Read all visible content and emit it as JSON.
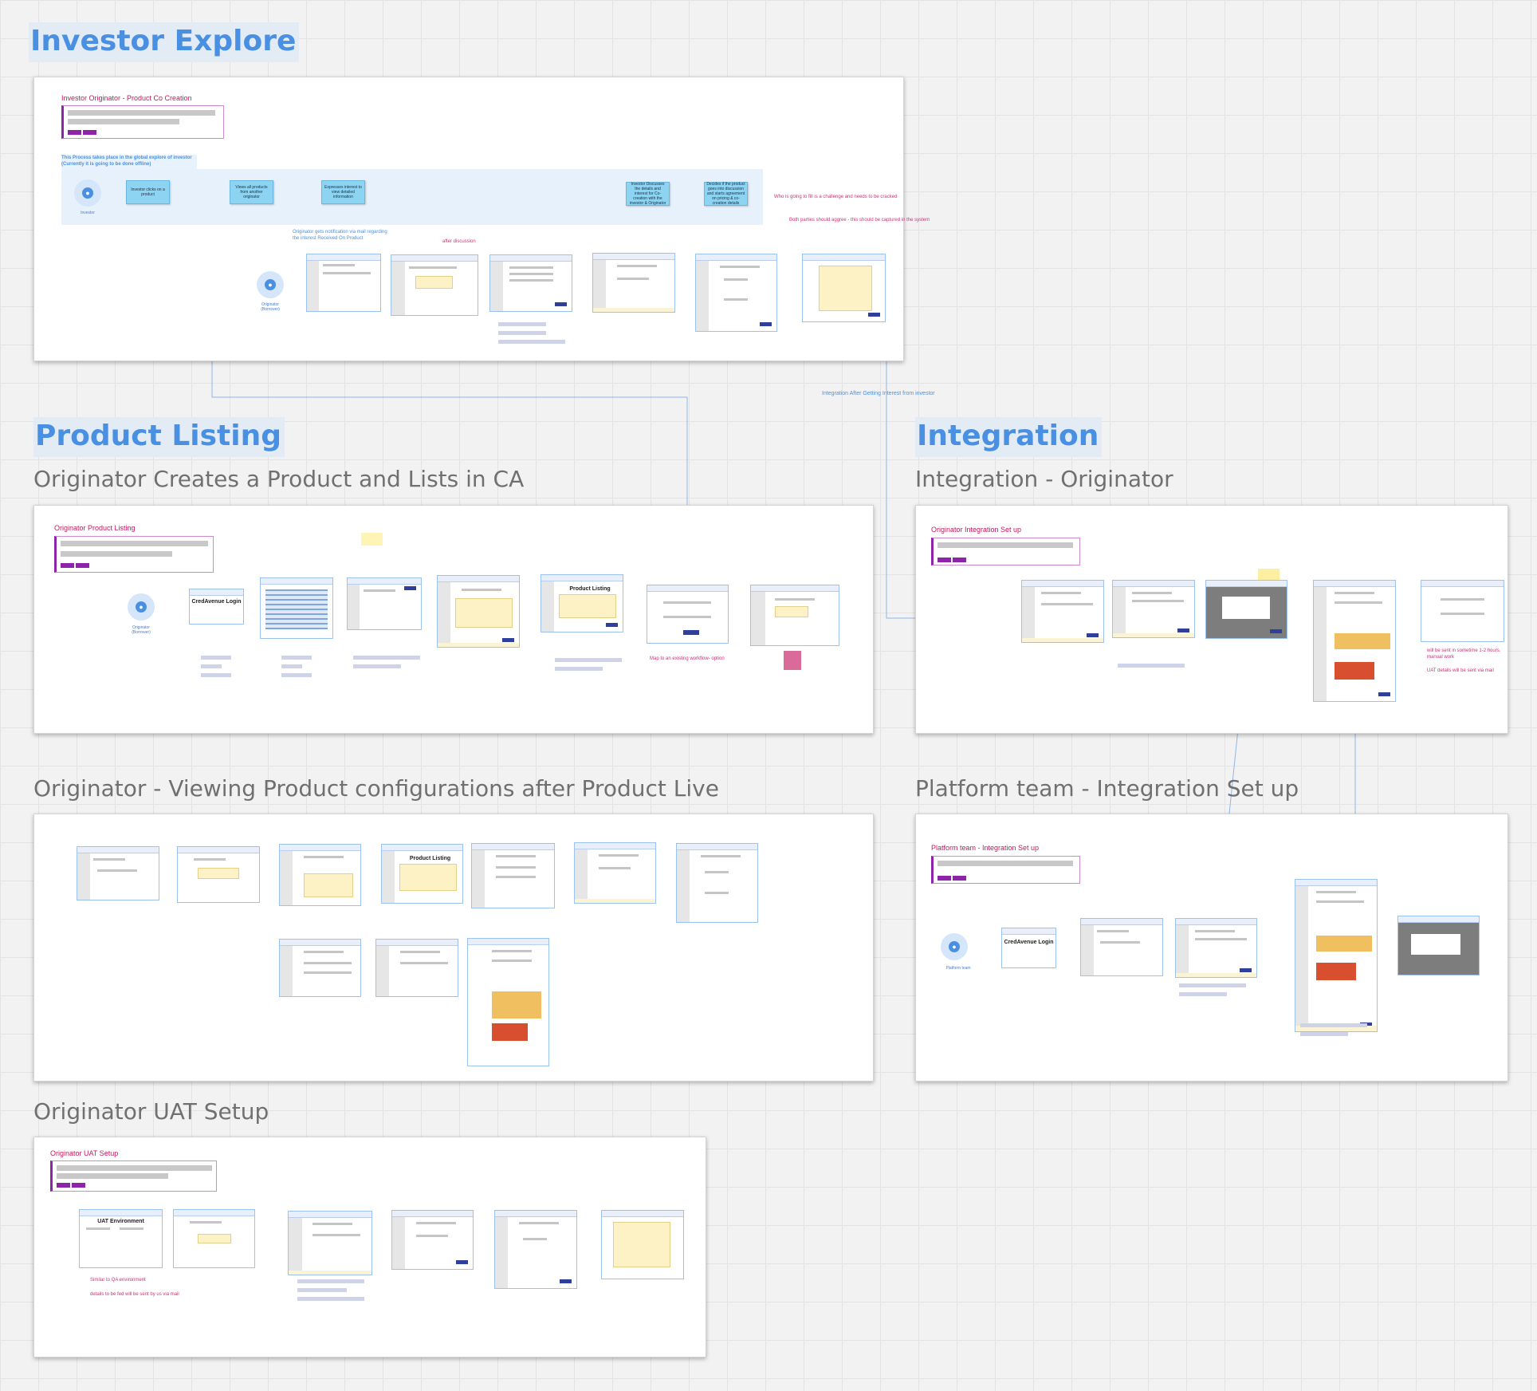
{
  "sections": {
    "investor_explore": "Investor Explore",
    "product_listing": "Product Listing",
    "integration": "Integration"
  },
  "subtitles": {
    "creates_product": "Originator Creates a Product and Lists in CA",
    "viewing_config": "Originator - Viewing Product configurations after Product Live",
    "uat_setup": "Originator UAT Setup",
    "integration_originator": "Integration - Originator",
    "platform_team": "Platform team - Integration Set up"
  },
  "frames": {
    "investor": {
      "label": "Investor Originator - Product Co Creation",
      "process_note": "This Process takes place in the global explore of investor",
      "process_note2": "(Currently it is going to be done offline)",
      "investor_label": "Investor",
      "originator_label": "Originator (Borrower)",
      "boxes": [
        "Investor clicks on a product",
        "Views all products from another originator",
        "Expresses interest to view detailed information",
        "Investor Discusses the details and interest for Co-creation with the investor & Originator",
        "Decides if the product goes into discussion and starts agreement on pricing & co-creation details"
      ],
      "mail_note": "Originator gets notification via mail regarding the interest Received On Product",
      "after_discussion": "after discussion",
      "challenge_note": "Who is going to fill is a challenge and needs to be cracked",
      "agree_note": "Both parties should aggree - this should be captured in the system",
      "integration_note": "Integration After Getting Interest from investor"
    },
    "product_listing": {
      "label": "Originator Product Listing",
      "originator_label": "Originator (Borrower)",
      "login_title": "CredAvenue Login",
      "product_listing_title": "Product Listing",
      "map_note": "Map to an existing workflow- option"
    },
    "viewing": {
      "product_listing_title": "Product Listing"
    },
    "uat": {
      "label": "Originator UAT Setup",
      "uat_title": "UAT Environment",
      "note1": "Similar to QA environment",
      "note2": "details to be fed will be sent by us via mail"
    },
    "integration": {
      "label": "Originator Integration Set up",
      "note1": "will be sent in sometime 1-2 hours. manual work",
      "note2": "UAT details will be sent via mail"
    },
    "platform": {
      "label": "Platform team - Integration Set up",
      "login_title": "CredAvenue Login",
      "platform_label": "Platform team"
    }
  },
  "colors": {
    "section_blue": "#4a90e2",
    "frame_label_magenta": "#c2185b",
    "accent_purple": "#8e24aa",
    "connector_blue": "#8fb6e8"
  }
}
